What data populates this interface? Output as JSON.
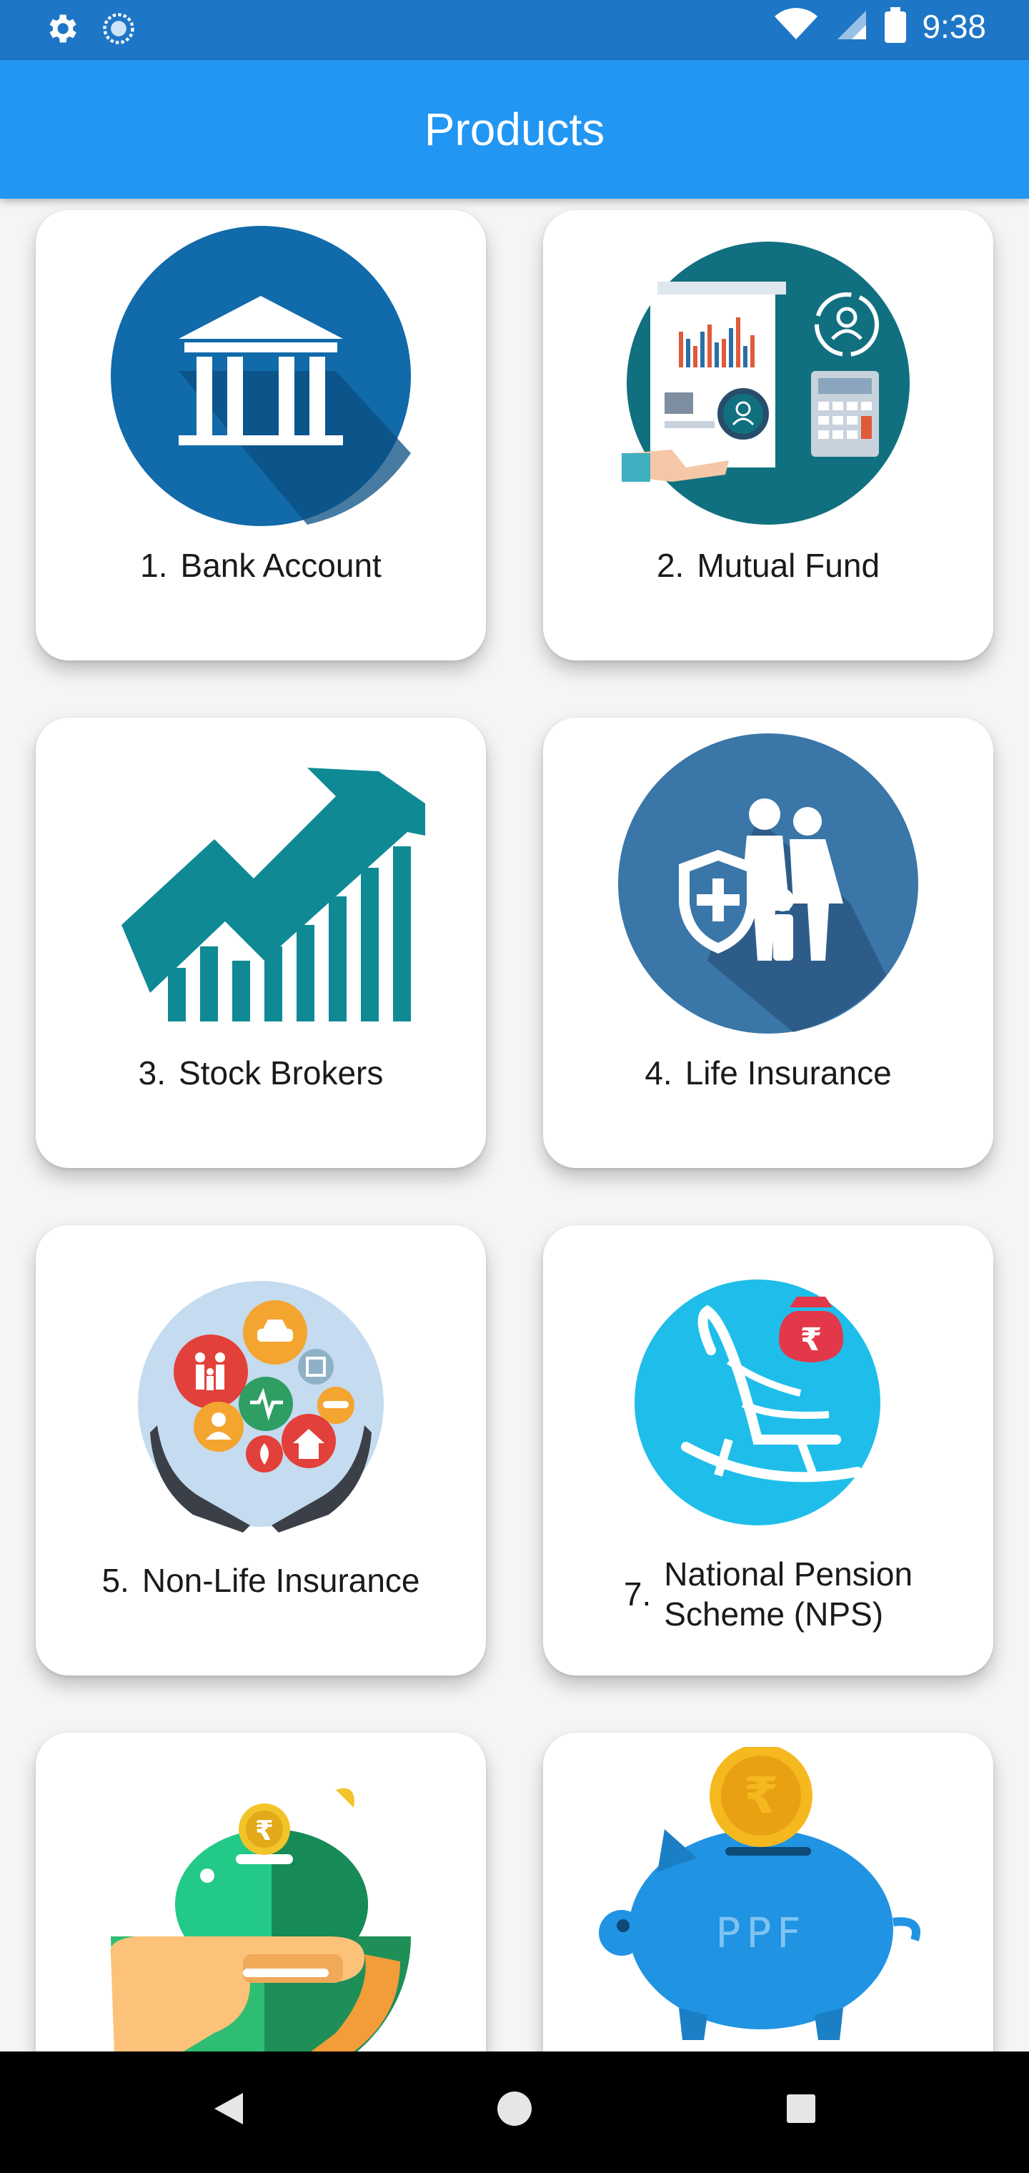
{
  "status_bar": {
    "time": "9:38",
    "icons": [
      "gear-icon",
      "sync-icon",
      "wifi-icon",
      "cellular-icon",
      "battery-icon"
    ]
  },
  "app_bar": {
    "title": "Products"
  },
  "products": [
    {
      "number": "1.",
      "label": "Bank Account",
      "icon": "bank-icon"
    },
    {
      "number": "2.",
      "label": "Mutual Fund",
      "icon": "mutual-fund-icon"
    },
    {
      "number": "3.",
      "label": "Stock Brokers",
      "icon": "stock-chart-icon"
    },
    {
      "number": "4.",
      "label": "Life Insurance",
      "icon": "family-shield-icon"
    },
    {
      "number": "5.",
      "label": "Non-Life Insurance",
      "icon": "insurance-hands-icon"
    },
    {
      "number": "7.",
      "label_line1": "National Pension",
      "label_line2": "Scheme (NPS)",
      "icon": "rocking-chair-icon"
    },
    {
      "icon": "piggy-bank-hand-icon"
    },
    {
      "icon": "ppf-piggy-bank-icon",
      "piggy_text": "PPF",
      "coin_symbol": "₹"
    }
  ],
  "nav_bar": {
    "icons": [
      "back-icon",
      "home-icon",
      "recents-icon"
    ]
  },
  "colors": {
    "app_bar": "#2196f3",
    "status_bar": "#1e76c7"
  }
}
